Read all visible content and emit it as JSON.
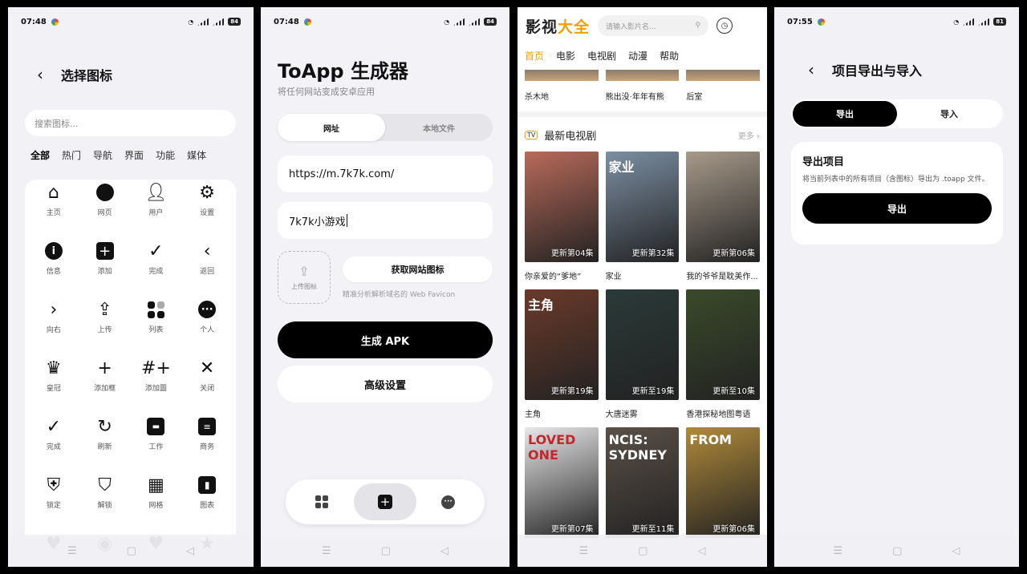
{
  "screens": {
    "icons": {
      "status": {
        "time": "07:48",
        "battery": "84"
      },
      "title": "选择图标",
      "search_placeholder": "搜索图标...",
      "tabs": [
        "全部",
        "热门",
        "导航",
        "界面",
        "功能",
        "媒体"
      ],
      "items": [
        {
          "label": "主页",
          "icon": "home-icon"
        },
        {
          "label": "网页",
          "icon": "globe-icon"
        },
        {
          "label": "用户",
          "icon": "user-icon"
        },
        {
          "label": "设置",
          "icon": "gear-icon"
        },
        {
          "label": "信息",
          "icon": "info-icon"
        },
        {
          "label": "添加",
          "icon": "add-box-icon"
        },
        {
          "label": "完成",
          "icon": "check-icon"
        },
        {
          "label": "返回",
          "icon": "chevron-left-icon"
        },
        {
          "label": "向右",
          "icon": "chevron-right-icon"
        },
        {
          "label": "上传",
          "icon": "upload-icon"
        },
        {
          "label": "列表",
          "icon": "grid-icon"
        },
        {
          "label": "个人",
          "icon": "more-icon"
        },
        {
          "label": "皇冠",
          "icon": "crown-icon"
        },
        {
          "label": "添加框",
          "icon": "plus-icon"
        },
        {
          "label": "添加圖",
          "icon": "add-image-icon"
        },
        {
          "label": "关闭",
          "icon": "close-icon"
        },
        {
          "label": "完成",
          "icon": "check-icon"
        },
        {
          "label": "刷新",
          "icon": "refresh-icon"
        },
        {
          "label": "工作",
          "icon": "briefcase-icon"
        },
        {
          "label": "商务",
          "icon": "chat-icon"
        },
        {
          "label": "锁定",
          "icon": "shield-icon"
        },
        {
          "label": "解锁",
          "icon": "shield-half-icon"
        },
        {
          "label": "网格",
          "icon": "building-icon"
        },
        {
          "label": "图表",
          "icon": "chart-icon"
        }
      ]
    },
    "generator": {
      "status": {
        "time": "07:48",
        "battery": "84"
      },
      "title": "ToApp 生成器",
      "subtitle": "将任何网站变成安卓应用",
      "tabs": [
        "网址",
        "本地文件"
      ],
      "url_value": "https://m.7k7k.com/",
      "name_value": "7k7k小游戏",
      "upload_label": "上传图标",
      "favicon_button": "获取网站图标",
      "favicon_hint": "精准分析解析域名的 Web Favicon",
      "generate_button": "生成 APK",
      "advanced_button": "高级设置"
    },
    "video": {
      "logo_a": "影视",
      "logo_b": "大全",
      "search_placeholder": "请输入影片名...",
      "nav": [
        "首页",
        "电影",
        "电视剧",
        "动漫",
        "帮助"
      ],
      "prev_titles": [
        "杀木地",
        "熊出没·年年有熊",
        "后室"
      ],
      "section_title": "最新电视剧",
      "section_tv_badge": "TV",
      "more_label": "更多",
      "cards": [
        {
          "title": "你亲爱的“爹地”",
          "tag": "更新第04集",
          "color": "#b86a5a",
          "poster_text": ""
        },
        {
          "title": "家业",
          "tag": "更新第32集",
          "color": "#7c8fa3",
          "poster_text": "家业"
        },
        {
          "title": "我的爷爷是耽美作...",
          "tag": "更新第06集",
          "color": "#a79a8a",
          "poster_text": ""
        },
        {
          "title": "主角",
          "tag": "更新第19集",
          "color": "#6b3a2a",
          "poster_text": "主角"
        },
        {
          "title": "大唐迷雾",
          "tag": "更新至19集",
          "color": "#2a3a38",
          "poster_text": ""
        },
        {
          "title": "香港探秘地图粤语",
          "tag": "更新至10集",
          "color": "#3a4a2a",
          "poster_text": ""
        },
        {
          "title": "",
          "tag": "更新第07集",
          "color": "#e8e8ea",
          "poster_text": "LOVED ONE"
        },
        {
          "title": "",
          "tag": "更新至11集",
          "color": "#5a5048",
          "poster_text": "NCIS: SYDNEY"
        },
        {
          "title": "",
          "tag": "更新第06集",
          "color": "#b08a3a",
          "poster_text": "FROM"
        }
      ]
    },
    "export": {
      "status": {
        "time": "07:55",
        "battery": "81"
      },
      "title": "项目导出与导入",
      "tabs": [
        "导出",
        "导入"
      ],
      "card_title": "导出项目",
      "card_desc": "将当前列表中的所有项目（含图标）导出为 .toapp 文件。",
      "card_button": "导出"
    }
  }
}
